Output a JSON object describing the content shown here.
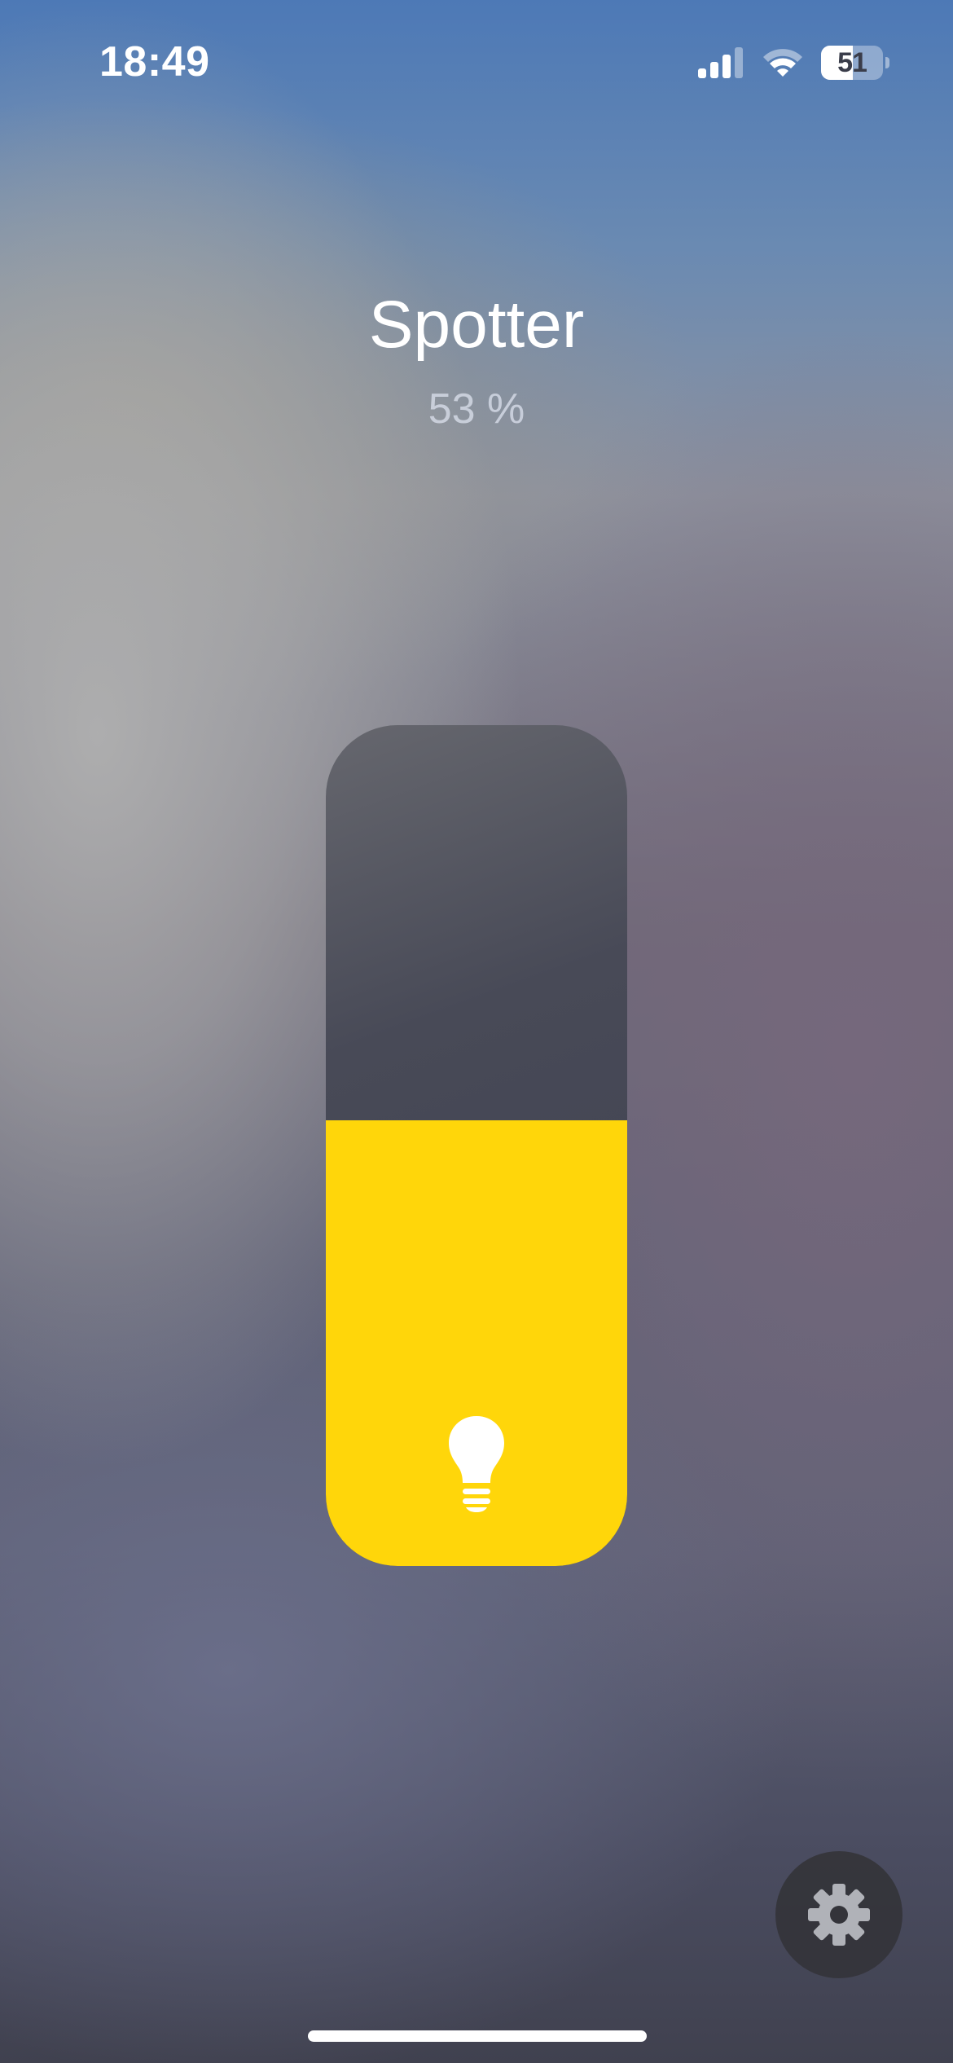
{
  "status_bar": {
    "time": "18:49",
    "battery_level": "51",
    "battery_fraction": 0.51,
    "signal_bars": 3,
    "icons": [
      "cellular-signal-icon",
      "wifi-icon",
      "battery-icon"
    ]
  },
  "accessory": {
    "name": "Spotter",
    "brightness_label": "53 %",
    "brightness_fraction": 0.53,
    "icon": "lightbulb-icon"
  },
  "settings": {
    "icon": "gear-icon"
  },
  "colors": {
    "accent": "#ffd60a",
    "slider_track": "#3e4050",
    "settings_button": "#34343a"
  }
}
